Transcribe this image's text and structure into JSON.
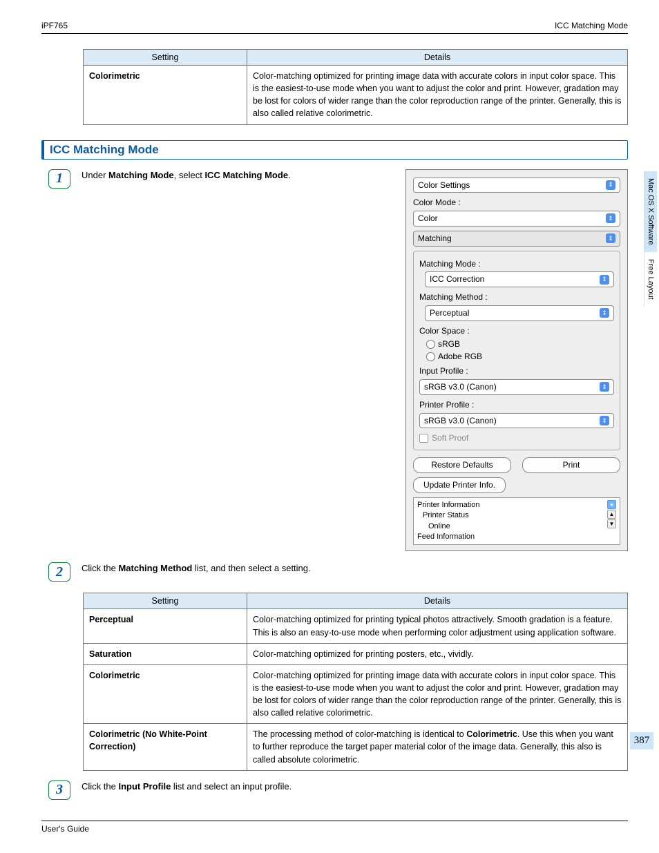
{
  "header": {
    "left": "iPF765",
    "right": "ICC Matching Mode"
  },
  "topTable": {
    "headers": {
      "setting": "Setting",
      "details": "Details"
    },
    "row": {
      "setting": "Colorimetric",
      "details": "Color-matching optimized for printing image data with accurate colors in input color space. This is the easiest-to-use mode when you want to adjust the color and print. However, gradation may be lost for colors of wider range than the color reproduction range of the printer. Generally, this is also called relative colorimetric."
    }
  },
  "sectionTitle": "ICC Matching Mode",
  "step1": {
    "num": "1",
    "pre": "Under ",
    "bold1": "Matching Mode",
    "mid": ", select ",
    "bold2": "ICC Matching Mode",
    "post": "."
  },
  "dialog": {
    "panelSelect": "Color Settings",
    "colorModeLabel": "Color Mode :",
    "colorMode": "Color",
    "matchingTab": "Matching",
    "matchingModeLabel": "Matching Mode :",
    "matchingMode": "ICC Correction",
    "matchingMethodLabel": "Matching Method :",
    "matchingMethod": "Perceptual",
    "colorSpaceLabel": "Color Space :",
    "radio1": "sRGB",
    "radio2": "Adobe RGB",
    "inputProfileLabel": "Input Profile :",
    "inputProfile": "sRGB v3.0 (Canon)",
    "printerProfileLabel": "Printer Profile :",
    "printerProfile": "sRGB v3.0 (Canon)",
    "softProof": "Soft Proof",
    "restoreDefaults": "Restore Defaults",
    "print": "Print",
    "updatePrinterInfo": "Update Printer Info.",
    "info": {
      "line1": "Printer Information",
      "line2": "Printer Status",
      "line3": "Online",
      "line4": "Feed Information"
    }
  },
  "step2": {
    "num": "2",
    "pre": "Click the ",
    "bold1": "Matching Method",
    "post": " list, and then select a setting."
  },
  "methodTable": {
    "headers": {
      "setting": "Setting",
      "details": "Details"
    },
    "rows": [
      {
        "setting": "Perceptual",
        "details": "Color-matching optimized for printing typical photos attractively. Smooth gradation is a feature. This is also an easy-to-use mode when performing color adjustment using application software."
      },
      {
        "setting": "Saturation",
        "details": "Color-matching optimized for printing posters, etc., vividly."
      },
      {
        "setting": "Colorimetric",
        "details": "Color-matching optimized for printing image data with accurate colors in input color space. This is the easiest-to-use mode when you want to adjust the color and print. However, gradation may be lost for colors of wider range than the color reproduction range of the printer. Generally, this is also called relative colorimetric."
      },
      {
        "setting": "Colorimetric (No White-Point Correction)",
        "details_pre": "The processing method of color-matching is identical to ",
        "details_bold": "Colorimetric",
        "details_post": ". Use this when you want to further reproduce the target paper material color of the image data. Generally, this also is called absolute colorimetric."
      }
    ]
  },
  "step3": {
    "num": "3",
    "pre": "Click the ",
    "bold1": "Input Profile",
    "post": " list and select an input profile."
  },
  "sideTabs": {
    "tab1": "Mac OS X Software",
    "tab2": "Free Layout"
  },
  "pageNumber": "387",
  "footer": "User's Guide"
}
